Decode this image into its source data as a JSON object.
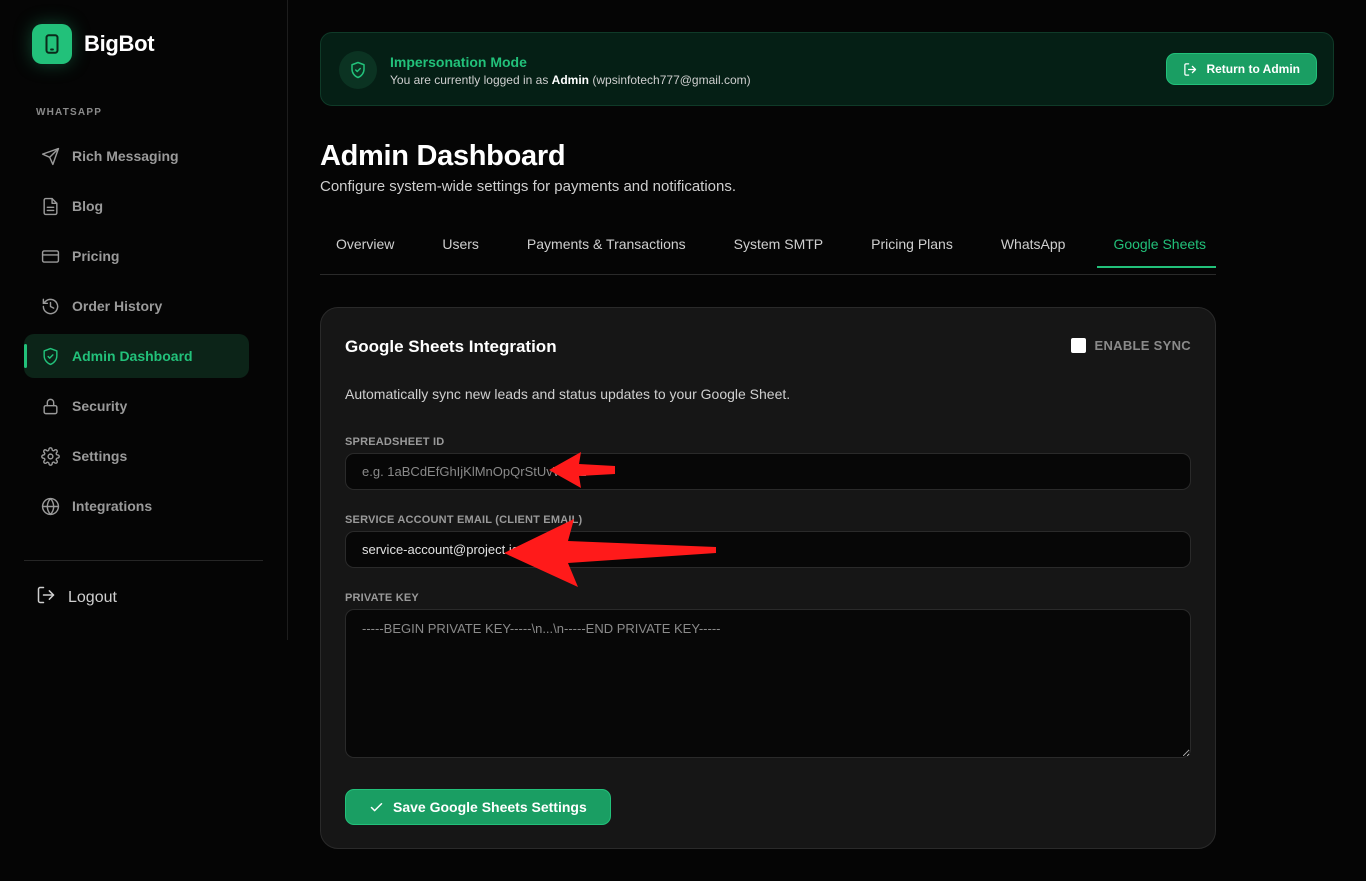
{
  "brand": {
    "name": "BigBot",
    "logo_icon": "phone-icon",
    "accent": "#22c17a"
  },
  "sidebar": {
    "section_label": "WHATSAPP",
    "items": [
      {
        "label": "Rich Messaging",
        "icon": "send-icon",
        "active": false
      },
      {
        "label": "Blog",
        "icon": "document-icon",
        "active": false
      },
      {
        "label": "Pricing",
        "icon": "credit-card-icon",
        "active": false
      },
      {
        "label": "Order History",
        "icon": "history-icon",
        "active": false
      },
      {
        "label": "Admin Dashboard",
        "icon": "shield-check-icon",
        "active": true
      },
      {
        "label": "Security",
        "icon": "lock-icon",
        "active": false
      },
      {
        "label": "Settings",
        "icon": "gear-icon",
        "active": false
      },
      {
        "label": "Integrations",
        "icon": "globe-icon",
        "active": false
      }
    ],
    "logout_label": "Logout"
  },
  "banner": {
    "title": "Impersonation Mode",
    "text_prefix": "You are currently logged in as",
    "user_name": "Admin",
    "user_email": "(wpsinfotech777@gmail.com)",
    "button_label": "Return to Admin"
  },
  "header": {
    "title": "Admin Dashboard",
    "subtitle": "Configure system-wide settings for payments and notifications."
  },
  "tabs": [
    {
      "label": "Overview",
      "active": false
    },
    {
      "label": "Users",
      "active": false
    },
    {
      "label": "Payments & Transactions",
      "active": false
    },
    {
      "label": "System SMTP",
      "active": false
    },
    {
      "label": "Pricing Plans",
      "active": false
    },
    {
      "label": "WhatsApp",
      "active": false
    },
    {
      "label": "Google Sheets",
      "active": true
    }
  ],
  "card": {
    "title": "Google Sheets Integration",
    "sync_label": "ENABLE SYNC",
    "sync_checked": false,
    "description": "Automatically sync new leads and status updates to your Google Sheet.",
    "spreadsheet_label": "SPREADSHEET ID",
    "spreadsheet_placeholder": "e.g. 1aBCdEfGhIjKlMnOpQrStUvWxYz",
    "spreadsheet_value": "",
    "email_label": "SERVICE ACCOUNT EMAIL (CLIENT EMAIL)",
    "email_value": "service-account@project.iam.gserviceaccount.com",
    "private_key_label": "PRIVATE KEY",
    "private_key_placeholder": "-----BEGIN PRIVATE KEY-----\\n...\\n-----END PRIVATE KEY-----",
    "save_label": "Save Google Sheets Settings"
  },
  "annotations": {
    "arrow_color": "#ff1a1a"
  }
}
